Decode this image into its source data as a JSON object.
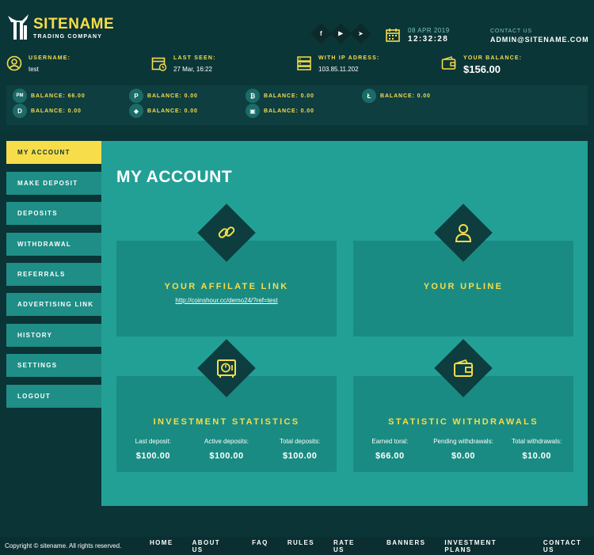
{
  "brand": {
    "name": "SITENAME",
    "tagline": "TRADING COMPANY"
  },
  "header": {
    "socials": [
      {
        "name": "facebook-icon",
        "glyph": "f"
      },
      {
        "name": "youtube-icon",
        "glyph": "▶"
      },
      {
        "name": "telegram-icon",
        "glyph": "➤"
      }
    ],
    "date": "08 APR 2019",
    "time": "12:32:28",
    "contact_label": "CONTACT US",
    "contact_email": "ADMIN@SITENAME.COM"
  },
  "info": {
    "username_label": "USERNAME:",
    "username_value": "test",
    "last_seen_label": "LAST SEEN:",
    "last_seen_value": "27 Mar, 16:22",
    "ip_label": "WITH IP ADRESS:",
    "ip_value": "103.85.11.202",
    "balance_label": "YOUR BALANCE:",
    "balance_value": "$156.00"
  },
  "balances": [
    {
      "icon": "perfect-money-icon",
      "glyph": "PM",
      "text": "BALANCE: 66.00"
    },
    {
      "icon": "payeer-icon",
      "glyph": "P",
      "text": "BALANCE: 0.00"
    },
    {
      "icon": "bitcoin-icon",
      "glyph": "₿",
      "text": "BALANCE: 0.00"
    },
    {
      "icon": "litecoin-icon",
      "glyph": "Ł",
      "text": "BALANCE: 0.00"
    },
    {
      "icon": "dash-icon",
      "glyph": "D",
      "text": "BALANCE: 0.00"
    },
    {
      "icon": "ethereum-icon",
      "glyph": "◆",
      "text": "BALANCE: 0.00"
    },
    {
      "icon": "cash-icon",
      "glyph": "▣",
      "text": "BALANCE: 0.00"
    }
  ],
  "sidebar": {
    "items": [
      {
        "label": "MY ACCOUNT"
      },
      {
        "label": "MAKE DEPOSIT"
      },
      {
        "label": "DEPOSITS"
      },
      {
        "label": "WITHDRAWAL"
      },
      {
        "label": "REFERRALS"
      },
      {
        "label": "ADVERTISING LINK"
      },
      {
        "label": "HISTORY"
      },
      {
        "label": "SETTINGS"
      },
      {
        "label": "LOGOUT"
      }
    ]
  },
  "main": {
    "title": "MY ACCOUNT",
    "affiliate": {
      "title": "YOUR AFFILATE LINK",
      "link": "http://coinshour.cc/demo24/?ref=test"
    },
    "upline": {
      "title": "YOUR UPLINE"
    },
    "investment": {
      "title": "INVESTMENT STATISTICS",
      "stats": [
        {
          "label": "Last deposit:",
          "value": "$100.00"
        },
        {
          "label": "Active deposits:",
          "value": "$100.00"
        },
        {
          "label": "Total deposits:",
          "value": "$100.00"
        }
      ]
    },
    "withdrawals": {
      "title": "STATISTIC WITHDRAWALS",
      "stats": [
        {
          "label": "Earned toral:",
          "value": "$66.00"
        },
        {
          "label": "Pending withdrawals:",
          "value": "$0.00"
        },
        {
          "label": "Total withdrawals:",
          "value": "$10.00"
        }
      ]
    }
  },
  "footer": {
    "copyright": "Copyright © sitename. All rights reserved.",
    "links": [
      "HOME",
      "ABOUT US",
      "FAQ",
      "RULES",
      "RATE US",
      "BANNERS",
      "INVESTMENT PLANS",
      "CONTACT US"
    ]
  },
  "colors": {
    "accent": "#f7dd4a",
    "panel": "#23a096",
    "card": "#1a8b82",
    "dark": "#0a3436"
  }
}
